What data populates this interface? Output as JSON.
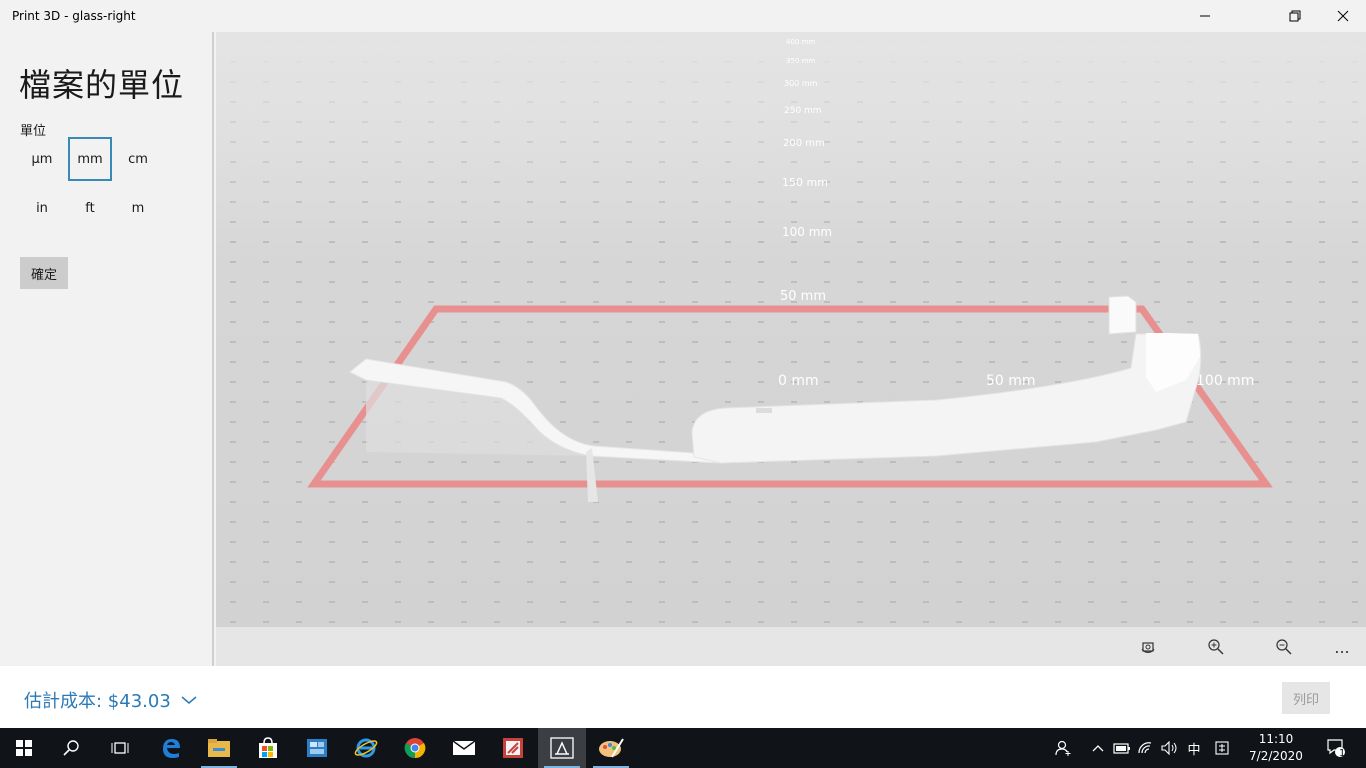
{
  "window": {
    "title": "Print 3D - glass-right"
  },
  "panel": {
    "title": "檔案的單位",
    "units_label": "單位",
    "units": [
      "µm",
      "mm",
      "cm",
      "in",
      "ft",
      "m"
    ],
    "selected_unit": "mm",
    "ok_label": "確定"
  },
  "viewport": {
    "axis_labels": [
      "400 mm",
      "350 mm",
      "300 mm",
      "250 mm",
      "200 mm",
      "150 mm",
      "100 mm",
      "50 mm",
      "0 mm",
      "50 mm",
      "100 mm"
    ]
  },
  "toolbar": {
    "icons": [
      "reset-view-icon",
      "zoom-in-icon",
      "zoom-out-icon",
      "more-icon"
    ],
    "more_label": "..."
  },
  "cost": {
    "label": "估計成本: $43.03",
    "print_label": "列印"
  },
  "taskbar": {
    "apps": [
      "start-icon",
      "search-icon",
      "task-view-icon",
      "edge-icon",
      "file-explorer-icon",
      "store-icon",
      "calculator-icon",
      "ie-icon",
      "chrome-icon",
      "mail-icon",
      "app-icon",
      "print3d-icon",
      "paint3d-icon"
    ],
    "ime": "中",
    "time": "11:10",
    "date": "7/2/2020",
    "notification_count": "1"
  },
  "colors": {
    "accent": "#2b7ab8",
    "selected_border": "#3a88b5",
    "print_bed": "#e88a8a"
  }
}
